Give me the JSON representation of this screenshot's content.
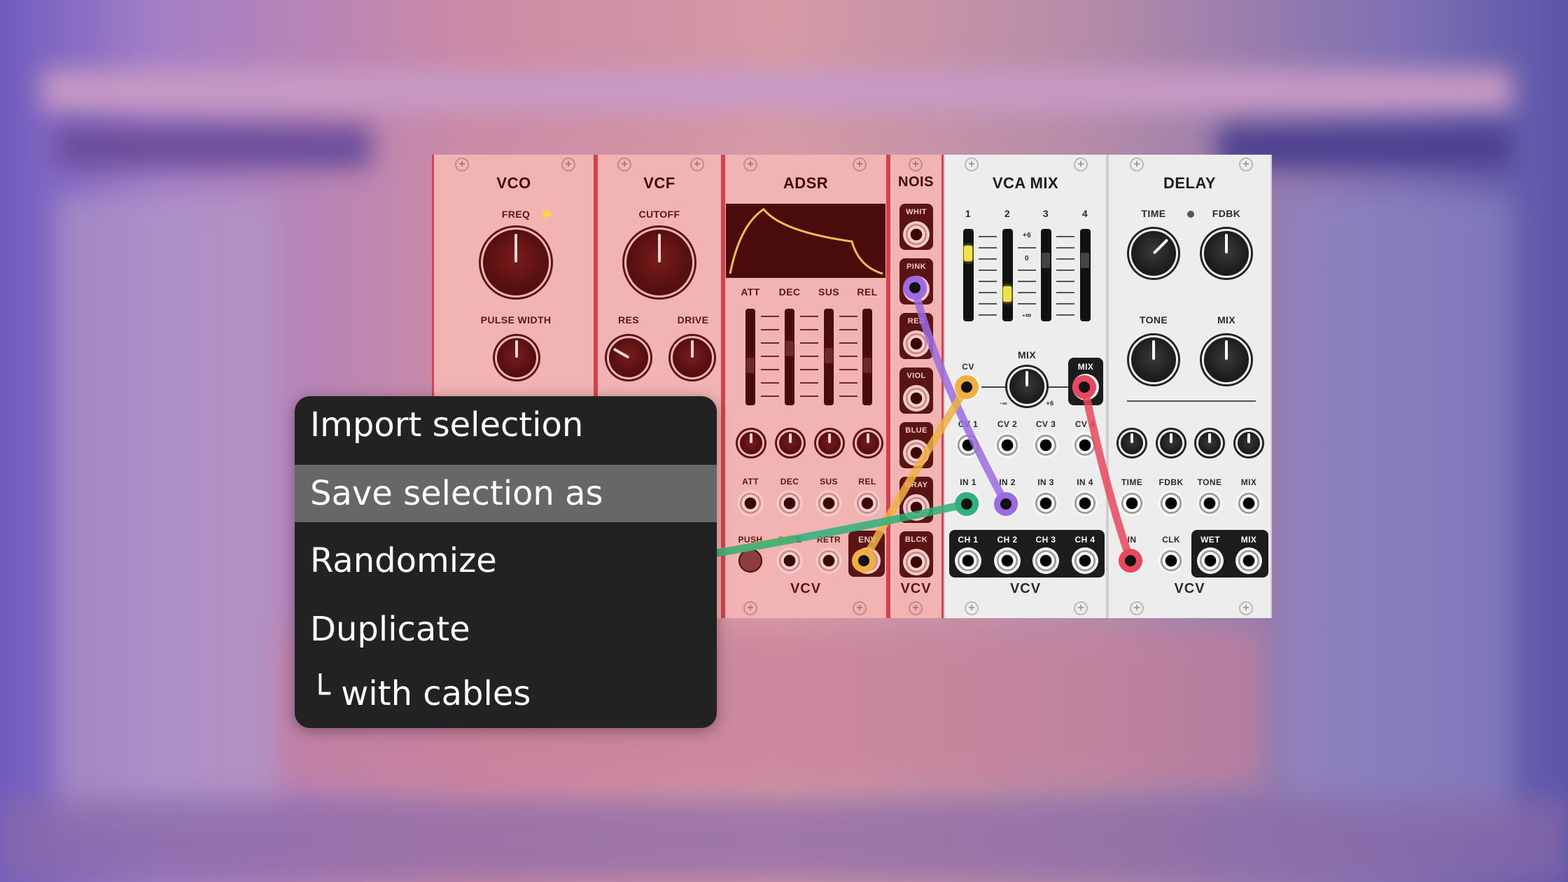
{
  "context_menu": {
    "items": [
      {
        "label": "Import selection",
        "highlighted": false
      },
      {
        "label": "Save selection as",
        "highlighted": true
      },
      {
        "label": "Randomize",
        "highlighted": false
      },
      {
        "label": "Duplicate",
        "highlighted": false
      },
      {
        "label": "└ with cables",
        "highlighted": false
      }
    ]
  },
  "modules": {
    "vco": {
      "title": "VCO",
      "freq": "FREQ",
      "pulse_width": "PULSE WIDTH"
    },
    "vcf": {
      "title": "VCF",
      "cutoff": "CUTOFF",
      "res": "RES",
      "drive": "DRIVE"
    },
    "adsr": {
      "title": "ADSR",
      "slider_labels": [
        "ATT",
        "DEC",
        "SUS",
        "REL"
      ],
      "cv_labels": [
        "ATT",
        "DEC",
        "SUS",
        "REL"
      ],
      "push": "PUSH",
      "gate": "GATE",
      "retr": "RETR",
      "env": "ENV",
      "brand": "VCV"
    },
    "nois": {
      "title": "NOIS",
      "outputs": [
        "WHIT",
        "PINK",
        "RED",
        "VIOL",
        "BLUE",
        "GRAY",
        "BLCK"
      ],
      "brand": "VCV"
    },
    "vca_mix": {
      "title": "VCA MIX",
      "channels": [
        "1",
        "2",
        "3",
        "4"
      ],
      "scale": [
        "+6",
        "0",
        "-∞"
      ],
      "cv": "CV",
      "mix": "MIX",
      "mix_out": "MIX",
      "mix_min": "-∞",
      "mix_max": "+6",
      "cv_inputs": [
        "CV 1",
        "CV 2",
        "CV 3",
        "CV 4"
      ],
      "inputs": [
        "IN 1",
        "IN 2",
        "IN 3",
        "IN 4"
      ],
      "outputs": [
        "CH 1",
        "CH 2",
        "CH 3",
        "CH 4"
      ],
      "brand": "VCV"
    },
    "delay": {
      "title": "DELAY",
      "time": "TIME",
      "fdbk": "FDBK",
      "tone": "TONE",
      "mix": "MIX",
      "cv_labels": [
        "TIME",
        "FDBK",
        "TONE",
        "MIX"
      ],
      "in": "IN",
      "clk": "CLK",
      "wet": "WET",
      "mix_out": "MIX",
      "brand": "VCV"
    }
  },
  "cables": [
    {
      "from": "NOIS PINK",
      "to": "VCA MIX IN 2",
      "color": "#9b6be0"
    },
    {
      "from": "ADSR ENV",
      "to": "VCA MIX CV",
      "color": "#f0b040"
    },
    {
      "from": "VCO (offscreen)",
      "to": "VCA MIX IN 1",
      "color": "#2fb27a"
    },
    {
      "from": "VCA MIX MIX",
      "to": "DELAY IN",
      "color": "#e8475d"
    }
  ],
  "colors": {
    "panel_pink": "#f2b3b3",
    "panel_border": "#d4434d",
    "panel_white": "#ededed",
    "menu_bg": "#222222",
    "menu_highlight": "#676767"
  }
}
